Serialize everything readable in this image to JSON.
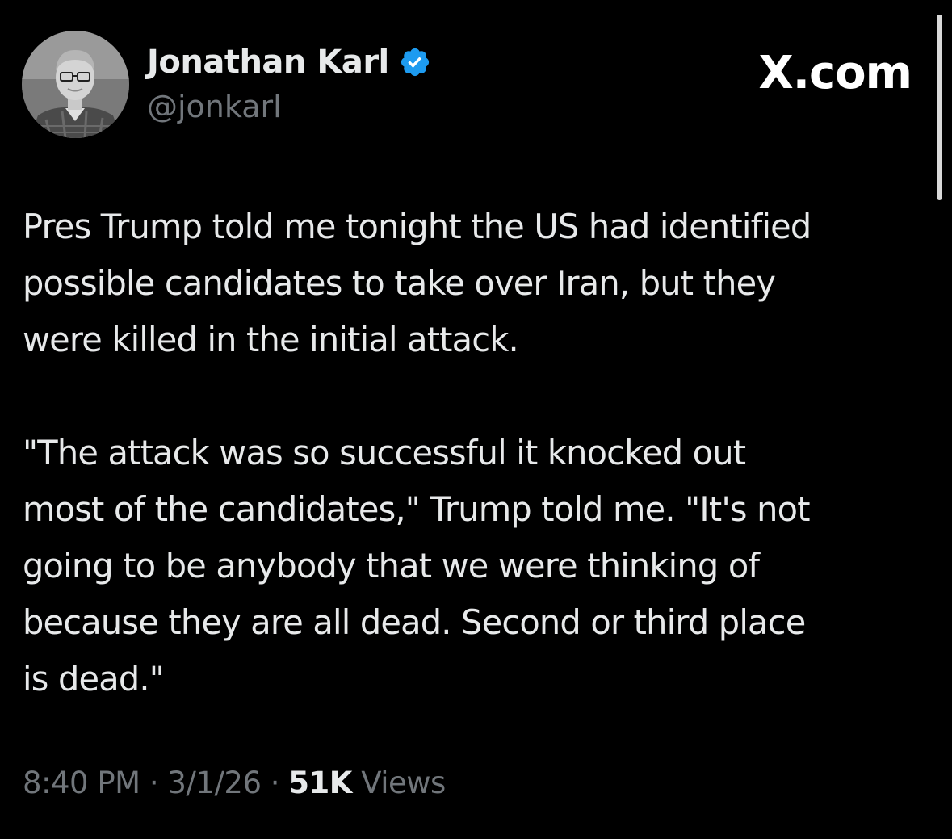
{
  "author": {
    "name": "Jonathan Karl",
    "handle": "@jonkarl",
    "verified_icon": "verified-badge-icon",
    "verified_color": "#1d9bf0"
  },
  "brand": {
    "label": "X.com"
  },
  "tweet": {
    "paragraph_1": "Pres Trump told me tonight the US had identified\npossible candidates to take over Iran, but they\nwere killed in the initial attack.",
    "paragraph_2": "\"The attack was so successful it knocked out\nmost of the candidates,\" Trump told me. \"It's not\ngoing to be anybody that we were thinking of\nbecause they are all dead. Second or third place\nis dead.\""
  },
  "meta": {
    "time": "8:40 PM",
    "separator": "·",
    "date": "3/1/26",
    "views_count": "51K",
    "views_label": "Views"
  },
  "colors": {
    "background": "#000000",
    "primary_text": "#e7e9ea",
    "secondary_text": "#71767b"
  }
}
